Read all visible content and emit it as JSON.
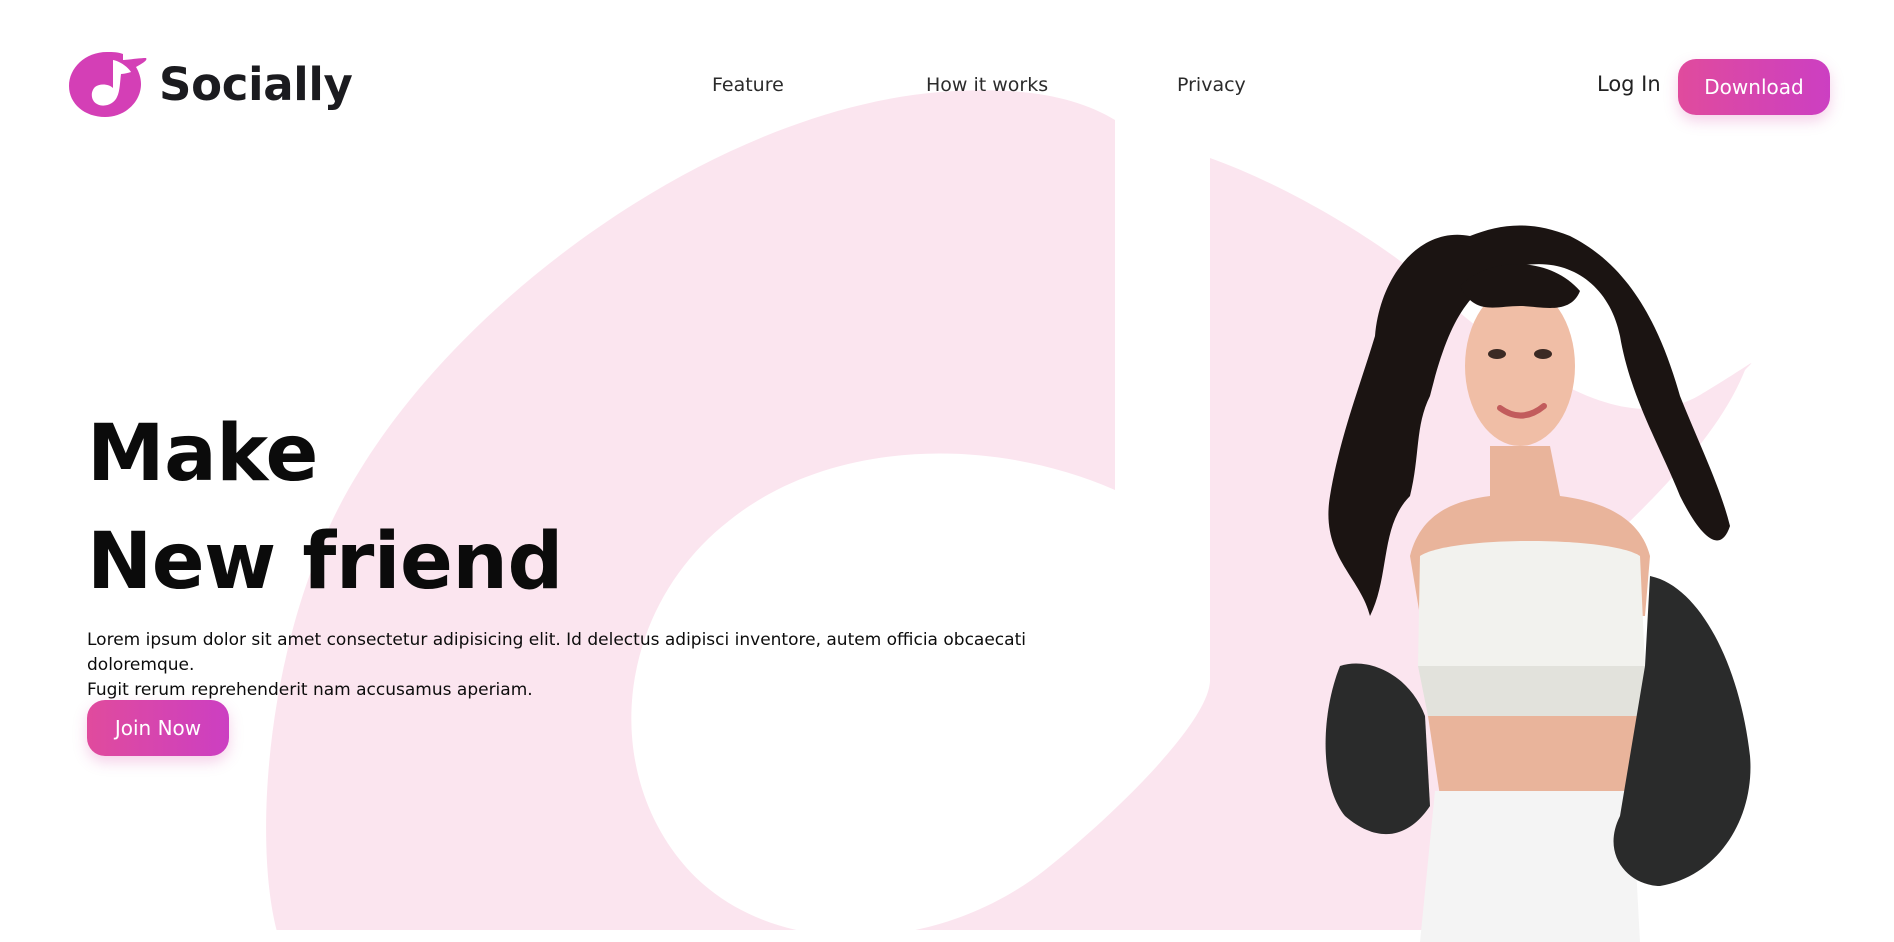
{
  "brand": {
    "name": "Socially",
    "accent": "#D43FB6",
    "button_gradient": [
      "#E04B9D",
      "#CC3FC2"
    ],
    "background_mark_color": "#FBE5EF"
  },
  "nav": {
    "links": [
      {
        "label": "Feature"
      },
      {
        "label": "How it works"
      },
      {
        "label": "Privacy"
      }
    ],
    "login_label": "Log In",
    "download_label": "Download"
  },
  "hero": {
    "heading_line1": "Make",
    "heading_line2": "New friend",
    "description_line1": "Lorem ipsum dolor sit amet consectetur adipisicing elit. Id delectus adipisci inventore, autem officia obcaecati doloremque.",
    "description_line2": "Fugit rerum reprehenderit nam accusamus aperiam.",
    "cta_label": "Join Now"
  },
  "image": {
    "icon": "model-photo-icon"
  }
}
